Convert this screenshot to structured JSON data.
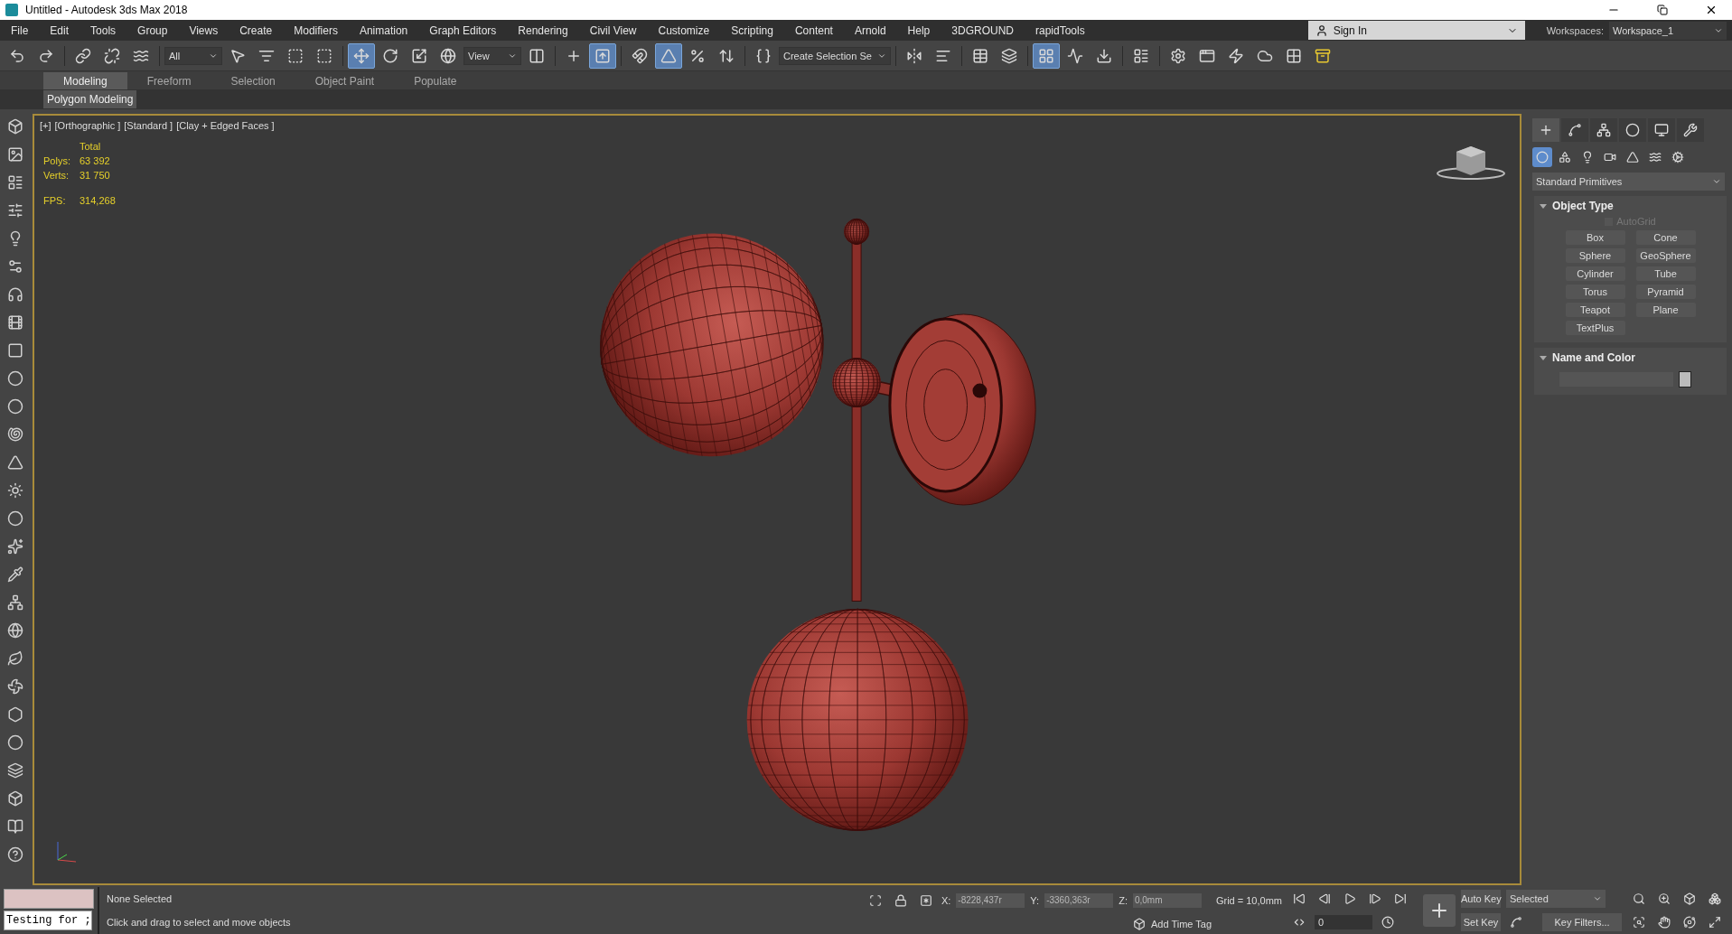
{
  "window": {
    "title": "Untitled - Autodesk 3ds Max 2018"
  },
  "menu": [
    "File",
    "Edit",
    "Tools",
    "Group",
    "Views",
    "Create",
    "Modifiers",
    "Animation",
    "Graph Editors",
    "Rendering",
    "Civil View",
    "Customize",
    "Scripting",
    "Content",
    "Arnold",
    "Help",
    "3DGROUND",
    "rapidTools"
  ],
  "account": {
    "sign_in": "Sign In",
    "workspaces_label": "Workspaces:",
    "workspace": "Workspace_1"
  },
  "toolbar": [
    {
      "kind": "button",
      "selected": false
    },
    {
      "kind": "button",
      "selected": false
    },
    {
      "kind": "sep"
    },
    {
      "kind": "button",
      "selected": false
    },
    {
      "kind": "button",
      "selected": false
    },
    {
      "kind": "button",
      "selected": false
    },
    {
      "kind": "sep"
    },
    {
      "kind": "dropdown",
      "value": "All"
    },
    {
      "kind": "button",
      "selected": false
    },
    {
      "kind": "button",
      "selected": false
    },
    {
      "kind": "button",
      "selected": false
    },
    {
      "kind": "button",
      "selected": false
    },
    {
      "kind": "sep"
    },
    {
      "kind": "button",
      "selected": true
    },
    {
      "kind": "button",
      "selected": false
    },
    {
      "kind": "button",
      "selected": false
    },
    {
      "kind": "button",
      "selected": false
    },
    {
      "kind": "dropdown",
      "value": "View"
    },
    {
      "kind": "button",
      "selected": false
    },
    {
      "kind": "sep"
    },
    {
      "kind": "button",
      "selected": false
    },
    {
      "kind": "button",
      "selected": true
    },
    {
      "kind": "sep"
    },
    {
      "kind": "button",
      "selected": false
    },
    {
      "kind": "button",
      "selected": true
    },
    {
      "kind": "button",
      "selected": false
    },
    {
      "kind": "button",
      "selected": false
    },
    {
      "kind": "sep"
    },
    {
      "kind": "button",
      "selected": false
    },
    {
      "kind": "dropdown",
      "value": "Create Selection Se"
    },
    {
      "kind": "sep"
    },
    {
      "kind": "button",
      "selected": false
    },
    {
      "kind": "button",
      "selected": false
    },
    {
      "kind": "sep"
    },
    {
      "kind": "button",
      "selected": false
    },
    {
      "kind": "button",
      "selected": false
    },
    {
      "kind": "sep"
    },
    {
      "kind": "button",
      "selected": true
    },
    {
      "kind": "button",
      "selected": false
    },
    {
      "kind": "button",
      "selected": false
    },
    {
      "kind": "sep"
    },
    {
      "kind": "button",
      "selected": false
    },
    {
      "kind": "sep"
    },
    {
      "kind": "button",
      "selected": false
    },
    {
      "kind": "button",
      "selected": false
    },
    {
      "kind": "button",
      "selected": false
    },
    {
      "kind": "button",
      "selected": false
    },
    {
      "kind": "button",
      "selected": false
    },
    {
      "kind": "button",
      "selected": false
    }
  ],
  "ribbon": {
    "tabs": [
      {
        "label": "Modeling",
        "selected": true
      },
      {
        "label": "Freeform",
        "selected": false
      },
      {
        "label": "Selection",
        "selected": false
      },
      {
        "label": "Object Paint",
        "selected": false
      },
      {
        "label": "Populate",
        "selected": false
      }
    ],
    "panel": "Polygon Modeling"
  },
  "viewport": {
    "labels": [
      "[+]",
      "[Orthographic ]",
      "[Standard ]",
      "[Clay + Edged Faces ]"
    ],
    "stats": {
      "header": "Total",
      "rows": [
        {
          "label": "Polys:",
          "value": "63 392"
        },
        {
          "label": "Verts:",
          "value": "31 750"
        }
      ],
      "fps": {
        "label": "FPS:",
        "value": "314,268"
      }
    }
  },
  "command_panel": {
    "tabs": [
      {
        "selected": true
      },
      {
        "selected": false
      },
      {
        "selected": false
      },
      {
        "selected": false
      },
      {
        "selected": false
      },
      {
        "selected": false
      }
    ],
    "categories": [
      {
        "selected": true
      },
      {
        "selected": false
      },
      {
        "selected": false
      },
      {
        "selected": false
      },
      {
        "selected": false
      },
      {
        "selected": false
      },
      {
        "selected": false
      }
    ],
    "dropdown": "Standard Primitives",
    "rollouts": [
      {
        "kind": "object_type",
        "title": "Object Type",
        "expanded": true,
        "autogrid": {
          "label": "AutoGrid",
          "checked": false,
          "disabled": true
        },
        "buttons": [
          "Box",
          "Cone",
          "Sphere",
          "GeoSphere",
          "Cylinder",
          "Tube",
          "Torus",
          "Pyramid",
          "Teapot",
          "Plane",
          "TextPlus"
        ]
      },
      {
        "kind": "name_color",
        "title": "Name and Color",
        "expanded": true
      }
    ]
  },
  "status": {
    "listener_input": "Testing for ;",
    "selection": "None Selected",
    "prompt": "Click and drag to select and move objects",
    "coords": [
      {
        "axis": "X:",
        "value": "-8228,437r"
      },
      {
        "axis": "Y:",
        "value": "-3360,363r"
      },
      {
        "axis": "Z:",
        "value": "0,0mm"
      }
    ],
    "grid": "Grid = 10,0mm",
    "time_tag": "Add Time Tag",
    "frame": "0",
    "auto_key": "Auto Key",
    "key_mode": "Selected",
    "set_key": "Set Key",
    "key_filters": "Key Filters..."
  }
}
